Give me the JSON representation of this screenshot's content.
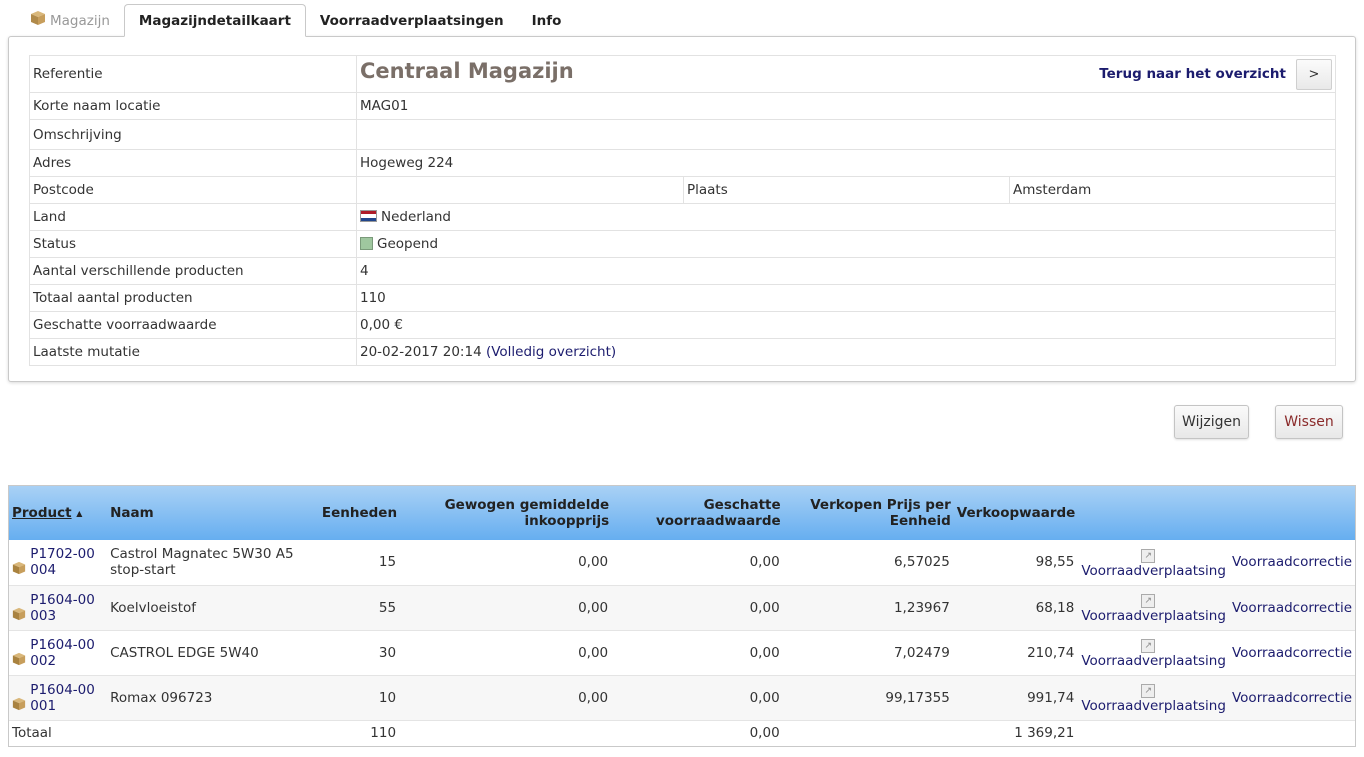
{
  "tabs": [
    {
      "label": "Magazijn",
      "state": "ghost"
    },
    {
      "label": "Magazijndetailkaart",
      "state": "active"
    },
    {
      "label": "Voorraadverplaatsingen",
      "state": "normal"
    },
    {
      "label": "Info",
      "state": "normal"
    }
  ],
  "warehouse": {
    "ref_label": "Referentie",
    "ref_value": "Centraal Magazijn",
    "back_link": "Terug naar het overzicht",
    "back_btn": ">",
    "short_label": "Korte naam locatie",
    "short_value": "MAG01",
    "desc_label": "Omschrijving",
    "desc_value": "",
    "address_label": "Adres",
    "address_value": "Hogeweg 224",
    "postcode_label": "Postcode",
    "postcode_value": "",
    "city_label": "Plaats",
    "city_value": "Amsterdam",
    "country_label": "Land",
    "country_value": "Nederland",
    "status_label": "Status",
    "status_value": "Geopend",
    "distinct_label": "Aantal verschillende producten",
    "distinct_value": "4",
    "total_label": "Totaal aantal producten",
    "total_value": "110",
    "value_label": "Geschatte voorraadwaarde",
    "value_value": "0,00 €",
    "last_label": "Laatste mutatie",
    "last_value": "20-02-2017 20:14",
    "last_link": "(Volledig overzicht)"
  },
  "buttons": {
    "edit": "Wijzigen",
    "delete": "Wissen"
  },
  "products": {
    "headers": {
      "product": "Product",
      "name": "Naam",
      "units": "Eenheden",
      "wac": "Gewogen gemiddelde inkoopprijs",
      "est": "Geschatte voorraadwaarde",
      "sale_unit": "Verkopen Prijs per Eenheid",
      "sale_value": "Verkoopwaarde"
    },
    "rows": [
      {
        "ref": "P1702-00004",
        "name": "Castrol Magnatec 5W30 A5 stop-start",
        "units": "15",
        "wac": "0,00",
        "est": "0,00",
        "sale_unit": "6,57025",
        "sale_value": "98,55",
        "move": "Voorraadverplaatsing",
        "correct": "Voorraadcorrectie"
      },
      {
        "ref": "P1604-00003",
        "name": "Koelvloeistof",
        "units": "55",
        "wac": "0,00",
        "est": "0,00",
        "sale_unit": "1,23967",
        "sale_value": "68,18",
        "move": "Voorraadverplaatsing",
        "correct": "Voorraadcorrectie"
      },
      {
        "ref": "P1604-00002",
        "name": "CASTROL EDGE 5W40",
        "units": "30",
        "wac": "0,00",
        "est": "0,00",
        "sale_unit": "7,02479",
        "sale_value": "210,74",
        "move": "Voorraadverplaatsing",
        "correct": "Voorraadcorrectie"
      },
      {
        "ref": "P1604-00001",
        "name": "Romax 096723",
        "units": "10",
        "wac": "0,00",
        "est": "0,00",
        "sale_unit": "99,17355",
        "sale_value": "991,74",
        "move": "Voorraadverplaatsing",
        "correct": "Voorraadcorrectie"
      }
    ],
    "footer": {
      "label": "Totaal",
      "units": "110",
      "est": "0,00",
      "sale_value": "1 369,21"
    }
  },
  "colors": {
    "header_top": "#a9d1f5",
    "header_bottom": "#66aef0",
    "link": "#1c1c6e",
    "status": "#9fc79f"
  }
}
